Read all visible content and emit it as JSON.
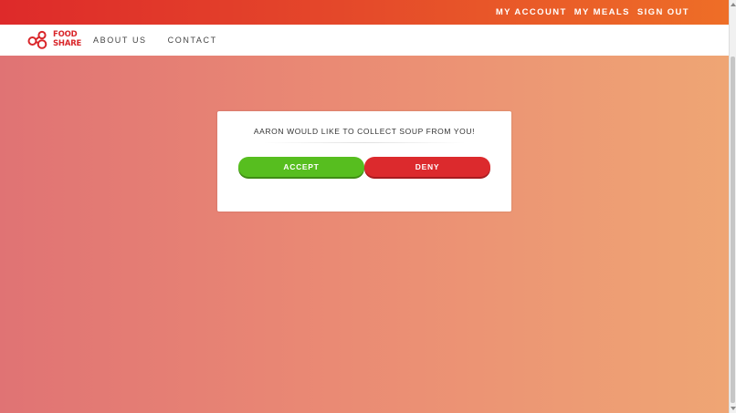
{
  "header": {
    "links": [
      "MY ACCOUNT",
      "MY MEALS",
      "SIGN OUT"
    ]
  },
  "brand": {
    "logo_line1": "FOOD",
    "logo_line2": "SHARE",
    "color": "#d9262a"
  },
  "nav": {
    "items": [
      "ABOUT US",
      "CONTACT"
    ]
  },
  "modal": {
    "message": "AARON WOULD LIKE TO COLLECT SOUP FROM YOU!",
    "accept_label": "ACCEPT",
    "deny_label": "DENY"
  },
  "colors": {
    "accent_top_bar": "#e4472a",
    "accept": "#57be1f",
    "deny": "#dc2a2d"
  },
  "icons": {
    "logo_mark": "linked-circles-icon"
  }
}
